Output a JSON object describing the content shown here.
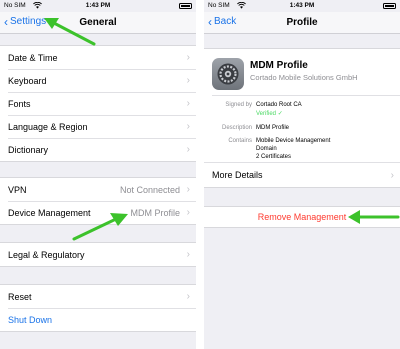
{
  "status_bar": {
    "carrier": "No SIM",
    "time": "1:43 PM"
  },
  "left": {
    "nav": {
      "back_label": "Settings",
      "title": "General"
    },
    "groups": [
      {
        "rows": [
          {
            "label": "Date & Time"
          },
          {
            "label": "Keyboard"
          },
          {
            "label": "Fonts"
          },
          {
            "label": "Language & Region"
          },
          {
            "label": "Dictionary"
          }
        ]
      },
      {
        "rows": [
          {
            "label": "VPN",
            "value": "Not Connected"
          },
          {
            "label": "Device Management",
            "value": "MDM Profile"
          }
        ]
      },
      {
        "rows": [
          {
            "label": "Legal & Regulatory"
          }
        ]
      },
      {
        "rows": [
          {
            "label": "Reset"
          },
          {
            "label": "Shut Down"
          }
        ]
      }
    ]
  },
  "right": {
    "nav": {
      "back_label": "Back",
      "title": "Profile"
    },
    "profile": {
      "name": "MDM Profile",
      "org": "Cortado Mobile Solutions GmbH"
    },
    "details": {
      "signed_by_label": "Signed by",
      "signed_by_value": "Cortado Root CA",
      "verified_label": "Verified",
      "description_label": "Description",
      "description_value": "MDM Profile",
      "contains_label": "Contains",
      "contains_values": [
        "Mobile Device Management",
        "Domain",
        "2 Certificates"
      ]
    },
    "more_details_label": "More Details",
    "remove_label": "Remove Management"
  },
  "colors": {
    "accent": "#1a73e8",
    "destructive": "#ff3b30",
    "arrow": "#3cc22b",
    "verified": "#4cd964"
  },
  "icons": [
    "wifi-icon",
    "battery-icon",
    "chevron-left-icon",
    "chevron-right-icon",
    "gear-icon",
    "checkmark-icon",
    "arrow-annotation"
  ]
}
